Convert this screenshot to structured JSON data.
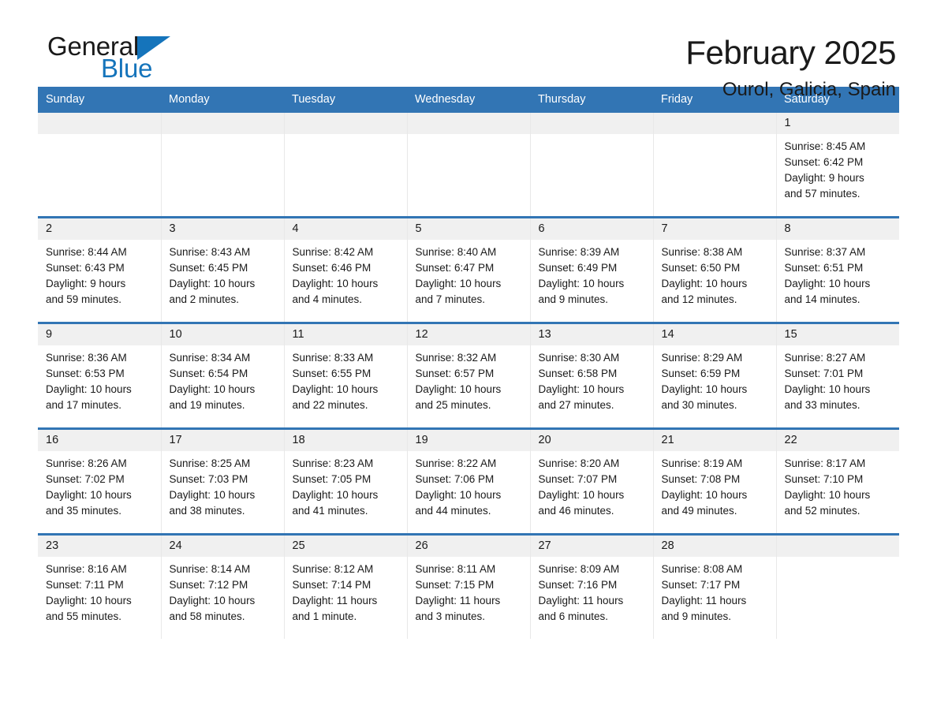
{
  "brand": {
    "name_part1": "General",
    "name_part2": "Blue",
    "accent_color": "#1574bb"
  },
  "header": {
    "title": "February 2025",
    "subtitle": "Ourol, Galicia, Spain"
  },
  "theme": {
    "header_blue": "#3275b4",
    "date_strip_gray": "#f0f0f0",
    "text_color": "#1a1a1a"
  },
  "day_headers": [
    "Sunday",
    "Monday",
    "Tuesday",
    "Wednesday",
    "Thursday",
    "Friday",
    "Saturday"
  ],
  "weeks": [
    [
      {
        "date": "",
        "lines": []
      },
      {
        "date": "",
        "lines": []
      },
      {
        "date": "",
        "lines": []
      },
      {
        "date": "",
        "lines": []
      },
      {
        "date": "",
        "lines": []
      },
      {
        "date": "",
        "lines": []
      },
      {
        "date": "1",
        "lines": [
          "Sunrise: 8:45 AM",
          "Sunset: 6:42 PM",
          "Daylight: 9 hours",
          "and 57 minutes."
        ]
      }
    ],
    [
      {
        "date": "2",
        "lines": [
          "Sunrise: 8:44 AM",
          "Sunset: 6:43 PM",
          "Daylight: 9 hours",
          "and 59 minutes."
        ]
      },
      {
        "date": "3",
        "lines": [
          "Sunrise: 8:43 AM",
          "Sunset: 6:45 PM",
          "Daylight: 10 hours",
          "and 2 minutes."
        ]
      },
      {
        "date": "4",
        "lines": [
          "Sunrise: 8:42 AM",
          "Sunset: 6:46 PM",
          "Daylight: 10 hours",
          "and 4 minutes."
        ]
      },
      {
        "date": "5",
        "lines": [
          "Sunrise: 8:40 AM",
          "Sunset: 6:47 PM",
          "Daylight: 10 hours",
          "and 7 minutes."
        ]
      },
      {
        "date": "6",
        "lines": [
          "Sunrise: 8:39 AM",
          "Sunset: 6:49 PM",
          "Daylight: 10 hours",
          "and 9 minutes."
        ]
      },
      {
        "date": "7",
        "lines": [
          "Sunrise: 8:38 AM",
          "Sunset: 6:50 PM",
          "Daylight: 10 hours",
          "and 12 minutes."
        ]
      },
      {
        "date": "8",
        "lines": [
          "Sunrise: 8:37 AM",
          "Sunset: 6:51 PM",
          "Daylight: 10 hours",
          "and 14 minutes."
        ]
      }
    ],
    [
      {
        "date": "9",
        "lines": [
          "Sunrise: 8:36 AM",
          "Sunset: 6:53 PM",
          "Daylight: 10 hours",
          "and 17 minutes."
        ]
      },
      {
        "date": "10",
        "lines": [
          "Sunrise: 8:34 AM",
          "Sunset: 6:54 PM",
          "Daylight: 10 hours",
          "and 19 minutes."
        ]
      },
      {
        "date": "11",
        "lines": [
          "Sunrise: 8:33 AM",
          "Sunset: 6:55 PM",
          "Daylight: 10 hours",
          "and 22 minutes."
        ]
      },
      {
        "date": "12",
        "lines": [
          "Sunrise: 8:32 AM",
          "Sunset: 6:57 PM",
          "Daylight: 10 hours",
          "and 25 minutes."
        ]
      },
      {
        "date": "13",
        "lines": [
          "Sunrise: 8:30 AM",
          "Sunset: 6:58 PM",
          "Daylight: 10 hours",
          "and 27 minutes."
        ]
      },
      {
        "date": "14",
        "lines": [
          "Sunrise: 8:29 AM",
          "Sunset: 6:59 PM",
          "Daylight: 10 hours",
          "and 30 minutes."
        ]
      },
      {
        "date": "15",
        "lines": [
          "Sunrise: 8:27 AM",
          "Sunset: 7:01 PM",
          "Daylight: 10 hours",
          "and 33 minutes."
        ]
      }
    ],
    [
      {
        "date": "16",
        "lines": [
          "Sunrise: 8:26 AM",
          "Sunset: 7:02 PM",
          "Daylight: 10 hours",
          "and 35 minutes."
        ]
      },
      {
        "date": "17",
        "lines": [
          "Sunrise: 8:25 AM",
          "Sunset: 7:03 PM",
          "Daylight: 10 hours",
          "and 38 minutes."
        ]
      },
      {
        "date": "18",
        "lines": [
          "Sunrise: 8:23 AM",
          "Sunset: 7:05 PM",
          "Daylight: 10 hours",
          "and 41 minutes."
        ]
      },
      {
        "date": "19",
        "lines": [
          "Sunrise: 8:22 AM",
          "Sunset: 7:06 PM",
          "Daylight: 10 hours",
          "and 44 minutes."
        ]
      },
      {
        "date": "20",
        "lines": [
          "Sunrise: 8:20 AM",
          "Sunset: 7:07 PM",
          "Daylight: 10 hours",
          "and 46 minutes."
        ]
      },
      {
        "date": "21",
        "lines": [
          "Sunrise: 8:19 AM",
          "Sunset: 7:08 PM",
          "Daylight: 10 hours",
          "and 49 minutes."
        ]
      },
      {
        "date": "22",
        "lines": [
          "Sunrise: 8:17 AM",
          "Sunset: 7:10 PM",
          "Daylight: 10 hours",
          "and 52 minutes."
        ]
      }
    ],
    [
      {
        "date": "23",
        "lines": [
          "Sunrise: 8:16 AM",
          "Sunset: 7:11 PM",
          "Daylight: 10 hours",
          "and 55 minutes."
        ]
      },
      {
        "date": "24",
        "lines": [
          "Sunrise: 8:14 AM",
          "Sunset: 7:12 PM",
          "Daylight: 10 hours",
          "and 58 minutes."
        ]
      },
      {
        "date": "25",
        "lines": [
          "Sunrise: 8:12 AM",
          "Sunset: 7:14 PM",
          "Daylight: 11 hours",
          "and 1 minute."
        ]
      },
      {
        "date": "26",
        "lines": [
          "Sunrise: 8:11 AM",
          "Sunset: 7:15 PM",
          "Daylight: 11 hours",
          "and 3 minutes."
        ]
      },
      {
        "date": "27",
        "lines": [
          "Sunrise: 8:09 AM",
          "Sunset: 7:16 PM",
          "Daylight: 11 hours",
          "and 6 minutes."
        ]
      },
      {
        "date": "28",
        "lines": [
          "Sunrise: 8:08 AM",
          "Sunset: 7:17 PM",
          "Daylight: 11 hours",
          "and 9 minutes."
        ]
      },
      {
        "date": "",
        "lines": []
      }
    ]
  ]
}
